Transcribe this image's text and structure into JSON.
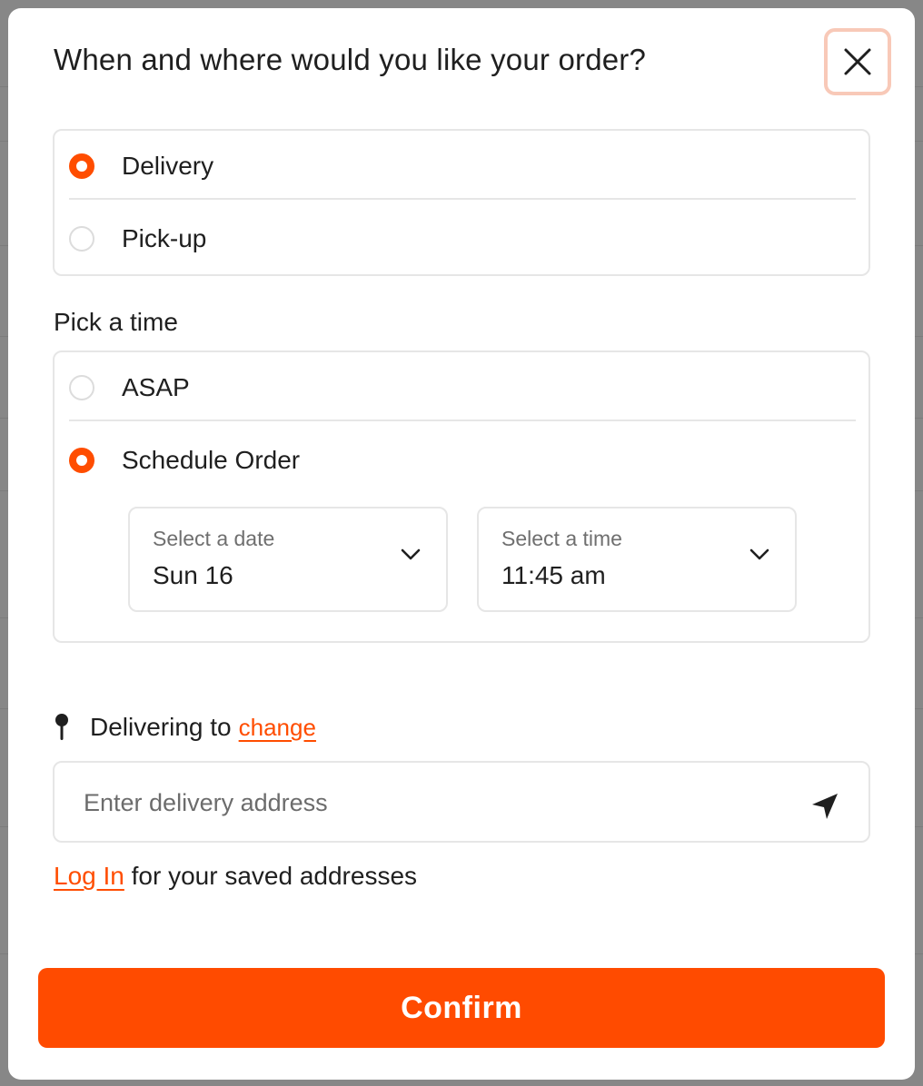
{
  "dialog": {
    "title": "When and where would you like your order?",
    "close_icon": "close-icon"
  },
  "order_type": {
    "options": [
      {
        "label": "Delivery",
        "selected": true
      },
      {
        "label": "Pick-up",
        "selected": false
      }
    ]
  },
  "time": {
    "section_label": "Pick a time",
    "options": [
      {
        "label": "ASAP",
        "selected": false
      },
      {
        "label": "Schedule Order",
        "selected": true
      }
    ],
    "date_select": {
      "label": "Select a date",
      "value": "Sun 16"
    },
    "time_select": {
      "label": "Select a time",
      "value": "11:45 am"
    }
  },
  "delivery": {
    "pin_icon": "map-pin-icon",
    "label": "Delivering to",
    "change_link": "change",
    "address_placeholder": "Enter delivery address",
    "locate_icon": "location-arrow-icon"
  },
  "login": {
    "link": "Log In",
    "text": "for your saved addresses"
  },
  "confirm_label": "Confirm",
  "colors": {
    "accent": "#ff4b00",
    "close_border": "#f8c9b8",
    "text": "#1f1f1f",
    "border": "#e6e6e6"
  }
}
